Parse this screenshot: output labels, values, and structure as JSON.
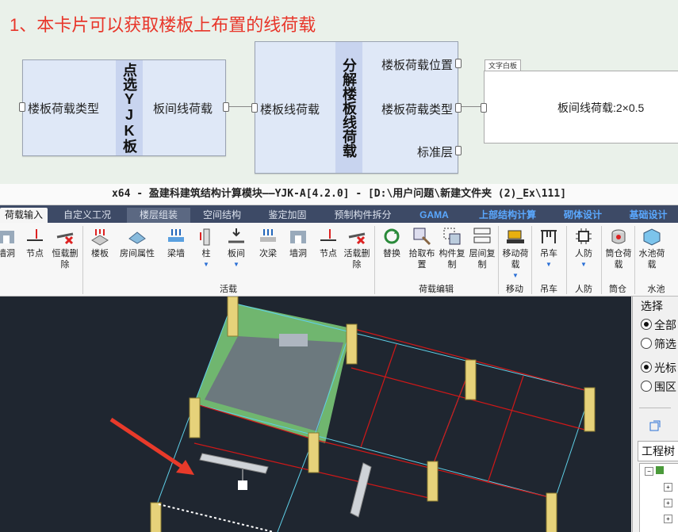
{
  "headline": "1、本卡片可以获取楼板上布置的线荷载",
  "nodes": {
    "picker": {
      "input": "楼板荷载类型",
      "title": "点选YJK板",
      "output": "板间线荷载"
    },
    "decompose": {
      "input": "楼板线荷载",
      "title": "分解楼板线荷载",
      "out1": "楼板荷载位置",
      "out2": "楼板荷载类型",
      "out3": "标准层"
    },
    "note": {
      "tab": "文字白板",
      "text": "板间线荷载:2×0.5"
    }
  },
  "app": {
    "title": "x64 - 盈建科建筑结构计算模块——YJK-A[4.2.0] - [D:\\用户问题\\新建文件夹 (2)_Ex\\111]",
    "tabs": [
      "荷载输入",
      "自定义工况",
      "楼层组装",
      "空间结构",
      "鉴定加固",
      "预制构件拆分",
      "GAMA",
      "上部结构计算",
      "砌体设计",
      "基础设计"
    ],
    "ribbon": {
      "buttons": [
        {
          "label": "墙洞",
          "icon": "wall-hole-icon"
        },
        {
          "label": "节点",
          "icon": "node-icon"
        },
        {
          "label": "恒载删除",
          "icon": "delete-load-icon"
        },
        {
          "label": "楼板",
          "icon": "slab-icon"
        },
        {
          "label": "房间属性",
          "icon": "room-icon"
        },
        {
          "label": "梁墙",
          "icon": "beam-wall-icon"
        },
        {
          "label": "柱",
          "icon": "column-icon"
        },
        {
          "label": "板间",
          "icon": "slab-between-icon"
        },
        {
          "label": "次梁",
          "icon": "secondary-beam-icon"
        },
        {
          "label": "墙洞",
          "icon": "wall-hole-icon"
        },
        {
          "label": "节点",
          "icon": "node-icon"
        },
        {
          "label": "活载删除",
          "icon": "delete-load-icon"
        },
        {
          "label": "替换",
          "icon": "replace-icon"
        },
        {
          "label": "拾取布置",
          "icon": "pick-icon"
        },
        {
          "label": "构件复制",
          "icon": "copy-icon"
        },
        {
          "label": "层间复制",
          "icon": "layer-copy-icon"
        },
        {
          "label": "移动荷载",
          "icon": "bulldozer-icon"
        },
        {
          "label": "吊车",
          "icon": "crane-icon"
        },
        {
          "label": "人防",
          "icon": "chip-icon"
        },
        {
          "label": "筒仓荷载",
          "icon": "silo-icon"
        },
        {
          "label": "水池荷载",
          "icon": "tank-icon"
        }
      ],
      "groups": [
        "活载",
        "荷载编辑",
        "移动",
        "吊车",
        "人防",
        "筒仓",
        "水池"
      ]
    },
    "panel": {
      "title": "选择",
      "options1": [
        "全部",
        "筛选"
      ],
      "options2": [
        "光标",
        "围区"
      ],
      "tree_label": "工程树"
    }
  },
  "colors": {
    "headline": "#e8362a",
    "slab_green": "#7fd07a",
    "grid_red": "#d01818",
    "grid_cyan": "#5fd0e8",
    "column_yellow": "#e6d27a"
  }
}
